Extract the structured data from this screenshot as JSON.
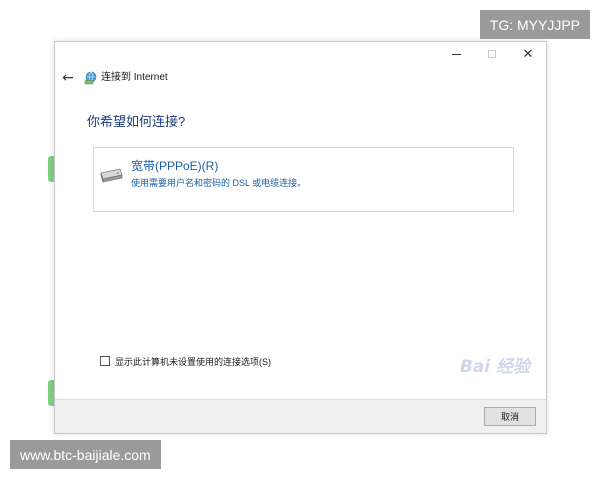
{
  "overlay": {
    "tg_text": "TG: MYYJJPP",
    "url_text": "www.btc-baijiale.com",
    "watermark_text": "Bai 经验"
  },
  "window": {
    "controls": {
      "close_glyph": "✕"
    },
    "nav": {
      "back_glyph": "←",
      "title": "连接到 Internet"
    },
    "heading": "你希望如何连接?",
    "option": {
      "title": "宽带(PPPoE)(R)",
      "description": "使用需要用户名和密码的 DSL 或电缆连接。",
      "icon": "broadband-modem-icon"
    },
    "checkbox": {
      "label": "显示此计算机未设置使用的连接选项(S)",
      "checked": false
    },
    "footer": {
      "cancel_label": "取消"
    }
  },
  "colors": {
    "heading": "#1f3c7a",
    "option_text": "#1b5fa8",
    "accent_green": "#7fd17f"
  }
}
